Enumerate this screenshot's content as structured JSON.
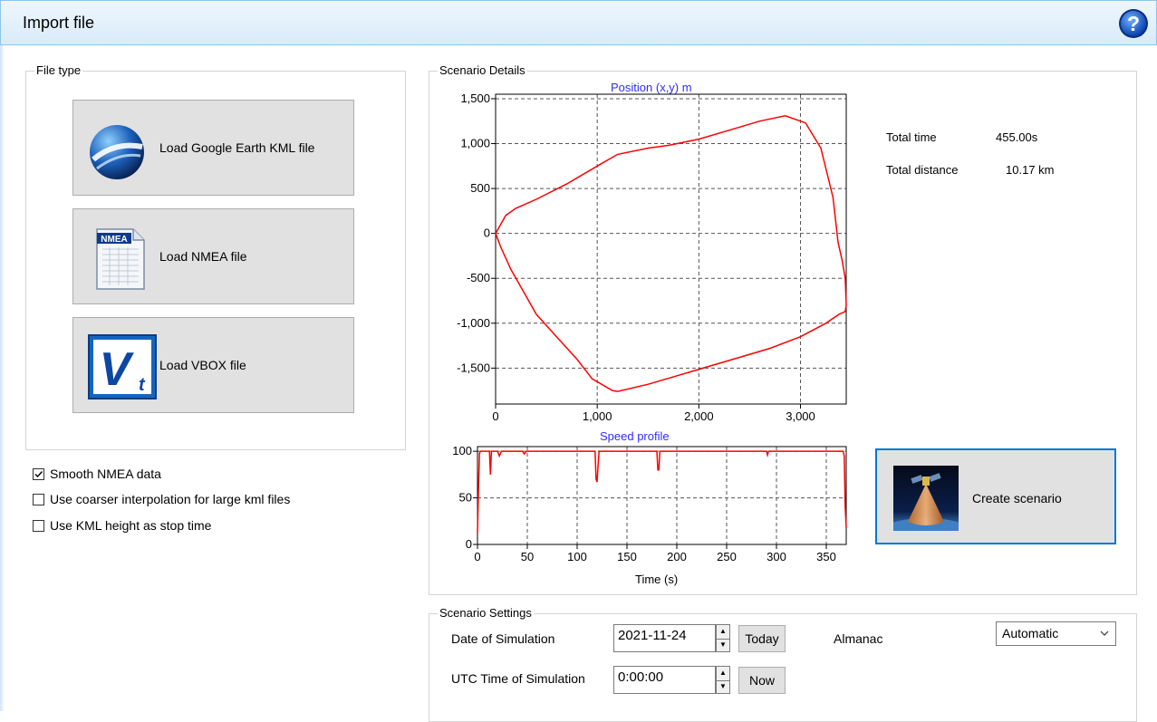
{
  "window": {
    "title": "Import file"
  },
  "file_type": {
    "legend": "File type",
    "buttons": [
      {
        "label": "Load Google Earth KML file",
        "icon": "google-earth-icon"
      },
      {
        "label": "Load NMEA file",
        "icon": "nmea-file-icon"
      },
      {
        "label": "Load VBOX file",
        "icon": "vbox-icon"
      }
    ]
  },
  "options": [
    {
      "label": "Smooth NMEA data",
      "checked": true
    },
    {
      "label": "Use coarser interpolation for large kml files",
      "checked": false
    },
    {
      "label": "Use KML height as stop time",
      "checked": false
    }
  ],
  "scenario_details": {
    "legend": "Scenario Details",
    "total_time_label": "Total time",
    "total_time_value": "455.00s",
    "total_distance_label": "Total distance",
    "total_distance_value": "10.17 km",
    "create_button_label": "Create scenario",
    "create_button_icon": "satellite-icon"
  },
  "chart_data": [
    {
      "type": "line",
      "title": "Position (x,y) m",
      "xlabel": "",
      "ylabel": "",
      "xlim": [
        0,
        3450
      ],
      "ylim": [
        -1900,
        1550
      ],
      "xticks": [
        "0",
        "1,000",
        "2,000",
        "3,000"
      ],
      "yticks": [
        "1,500",
        "1,000",
        "500",
        "0",
        "-500",
        "-1,000",
        "-1,500"
      ],
      "grid": true,
      "series": [
        {
          "color": "#ff0000",
          "x": [
            0,
            100,
            200,
            400,
            700,
            1000,
            1200,
            1500,
            1700,
            2000,
            2300,
            2600,
            2850,
            3050,
            3200,
            3320,
            3370,
            3410,
            3440,
            3450,
            3440,
            3380,
            3250,
            3000,
            2700,
            2400,
            2100,
            1800,
            1500,
            1200,
            1150,
            950,
            800,
            600,
            400,
            300,
            150,
            50,
            0
          ],
          "y": [
            0,
            200,
            280,
            380,
            550,
            750,
            880,
            950,
            980,
            1050,
            1150,
            1250,
            1310,
            1230,
            950,
            400,
            -100,
            -300,
            -500,
            -800,
            -870,
            -900,
            -1000,
            -1150,
            -1280,
            -1380,
            -1480,
            -1580,
            -1680,
            -1760,
            -1750,
            -1620,
            -1400,
            -1150,
            -900,
            -700,
            -400,
            -150,
            0
          ]
        }
      ]
    },
    {
      "type": "line",
      "title": "Speed profile",
      "xlabel": "Time (s)",
      "ylabel": "",
      "xlim": [
        0,
        370
      ],
      "ylim": [
        0,
        105
      ],
      "xticks": [
        "0",
        "50",
        "100",
        "150",
        "200",
        "250",
        "300",
        "350"
      ],
      "yticks": [
        "100",
        "50",
        "0"
      ],
      "grid": true,
      "series": [
        {
          "color": "#ff0000",
          "x": [
            0,
            1,
            2,
            3,
            12,
            13,
            14,
            15,
            20,
            22,
            24,
            45,
            47,
            49,
            118,
            119,
            120,
            121,
            122,
            180,
            181,
            182,
            183,
            290,
            291,
            292,
            367,
            368,
            369,
            370
          ],
          "y": [
            12,
            60,
            98,
            100,
            100,
            75,
            100,
            100,
            100,
            95,
            100,
            100,
            97,
            100,
            100,
            70,
            67,
            85,
            100,
            100,
            80,
            80,
            100,
            100,
            96,
            100,
            100,
            95,
            40,
            18
          ]
        }
      ]
    }
  ],
  "scenario_settings": {
    "legend": "Scenario Settings",
    "date_label": "Date of Simulation",
    "date_value": "2021-11-24",
    "today_button": "Today",
    "time_label": "UTC Time of Simulation",
    "time_value": "0:00:00",
    "now_button": "Now",
    "almanac_label": "Almanac",
    "almanac_value": "Automatic"
  }
}
